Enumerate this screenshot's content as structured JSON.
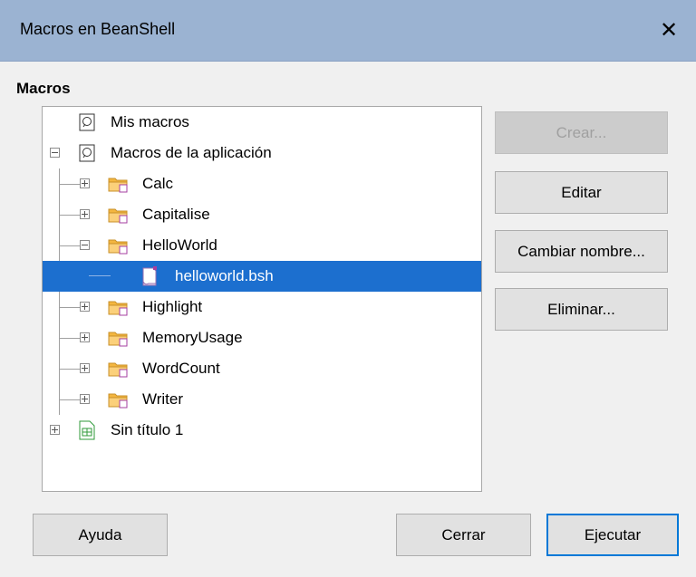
{
  "window": {
    "title": "Macros en BeanShell",
    "close_symbol": "✕"
  },
  "section": {
    "label": "Macros"
  },
  "tree": {
    "items": [
      {
        "label": "Mis macros",
        "icon": "macro-library-icon"
      },
      {
        "label": "Macros de la aplicación",
        "icon": "macro-library-icon",
        "expanded": true
      },
      {
        "label": "Calc",
        "icon": "folder-icon"
      },
      {
        "label": "Capitalise",
        "icon": "folder-icon"
      },
      {
        "label": "HelloWorld",
        "icon": "folder-icon",
        "expanded": true
      },
      {
        "label": "helloworld.bsh",
        "icon": "script-file-icon",
        "selected": true
      },
      {
        "label": "Highlight",
        "icon": "folder-icon"
      },
      {
        "label": "MemoryUsage",
        "icon": "folder-icon"
      },
      {
        "label": "WordCount",
        "icon": "folder-icon"
      },
      {
        "label": "Writer",
        "icon": "folder-icon"
      },
      {
        "label": "Sin título 1",
        "icon": "spreadsheet-document-icon"
      }
    ]
  },
  "buttons": {
    "create": "Crear...",
    "edit": "Editar",
    "rename": "Cambiar nombre...",
    "delete": "Eliminar...",
    "help": "Ayuda",
    "close": "Cerrar",
    "run": "Ejecutar"
  },
  "colors": {
    "titlebar": "#9bb3d2",
    "selection": "#1c6fcf",
    "folder": "#f4b63f",
    "default_button_border": "#0078d7"
  }
}
